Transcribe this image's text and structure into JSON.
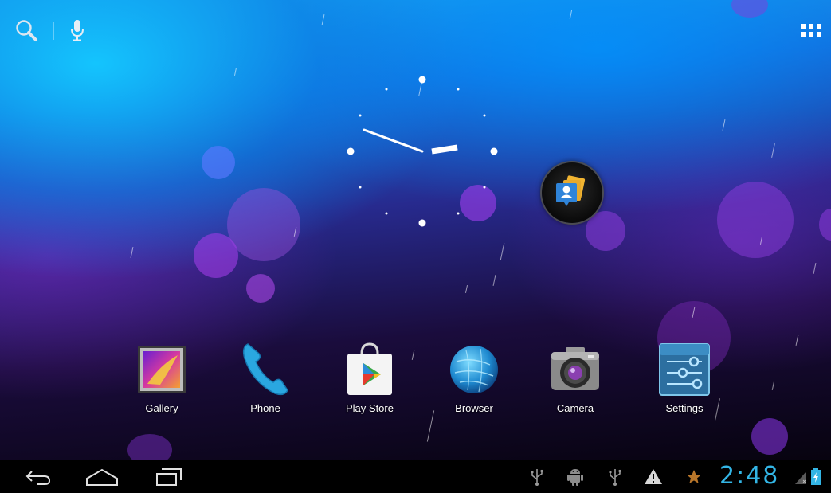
{
  "top_bar": {
    "search_icon": "search-icon",
    "voice_icon": "mic-icon",
    "apps_icon": "app-drawer-icon"
  },
  "widgets": {
    "clock": "analog-clock",
    "folder_icon": "contacts-folder-icon"
  },
  "dock": {
    "apps": [
      {
        "label": "Gallery",
        "icon": "gallery-icon"
      },
      {
        "label": "Phone",
        "icon": "phone-icon"
      },
      {
        "label": "Play Store",
        "icon": "play-store-icon"
      },
      {
        "label": "Browser",
        "icon": "browser-icon"
      },
      {
        "label": "Camera",
        "icon": "camera-icon"
      },
      {
        "label": "Settings",
        "icon": "settings-icon"
      }
    ]
  },
  "nav_bar": {
    "buttons": [
      "back-icon",
      "home-icon",
      "recent-apps-icon"
    ],
    "status_icons": [
      "usb-icon",
      "android-debug-icon",
      "usb-icon",
      "warning-icon",
      "star-icon"
    ],
    "time": "2:48",
    "battery_icon": "battery-charging-icon",
    "signal_icon": "signal-icon"
  },
  "colors": {
    "accent": "#33b5e5",
    "nav_bar": "#000000"
  }
}
